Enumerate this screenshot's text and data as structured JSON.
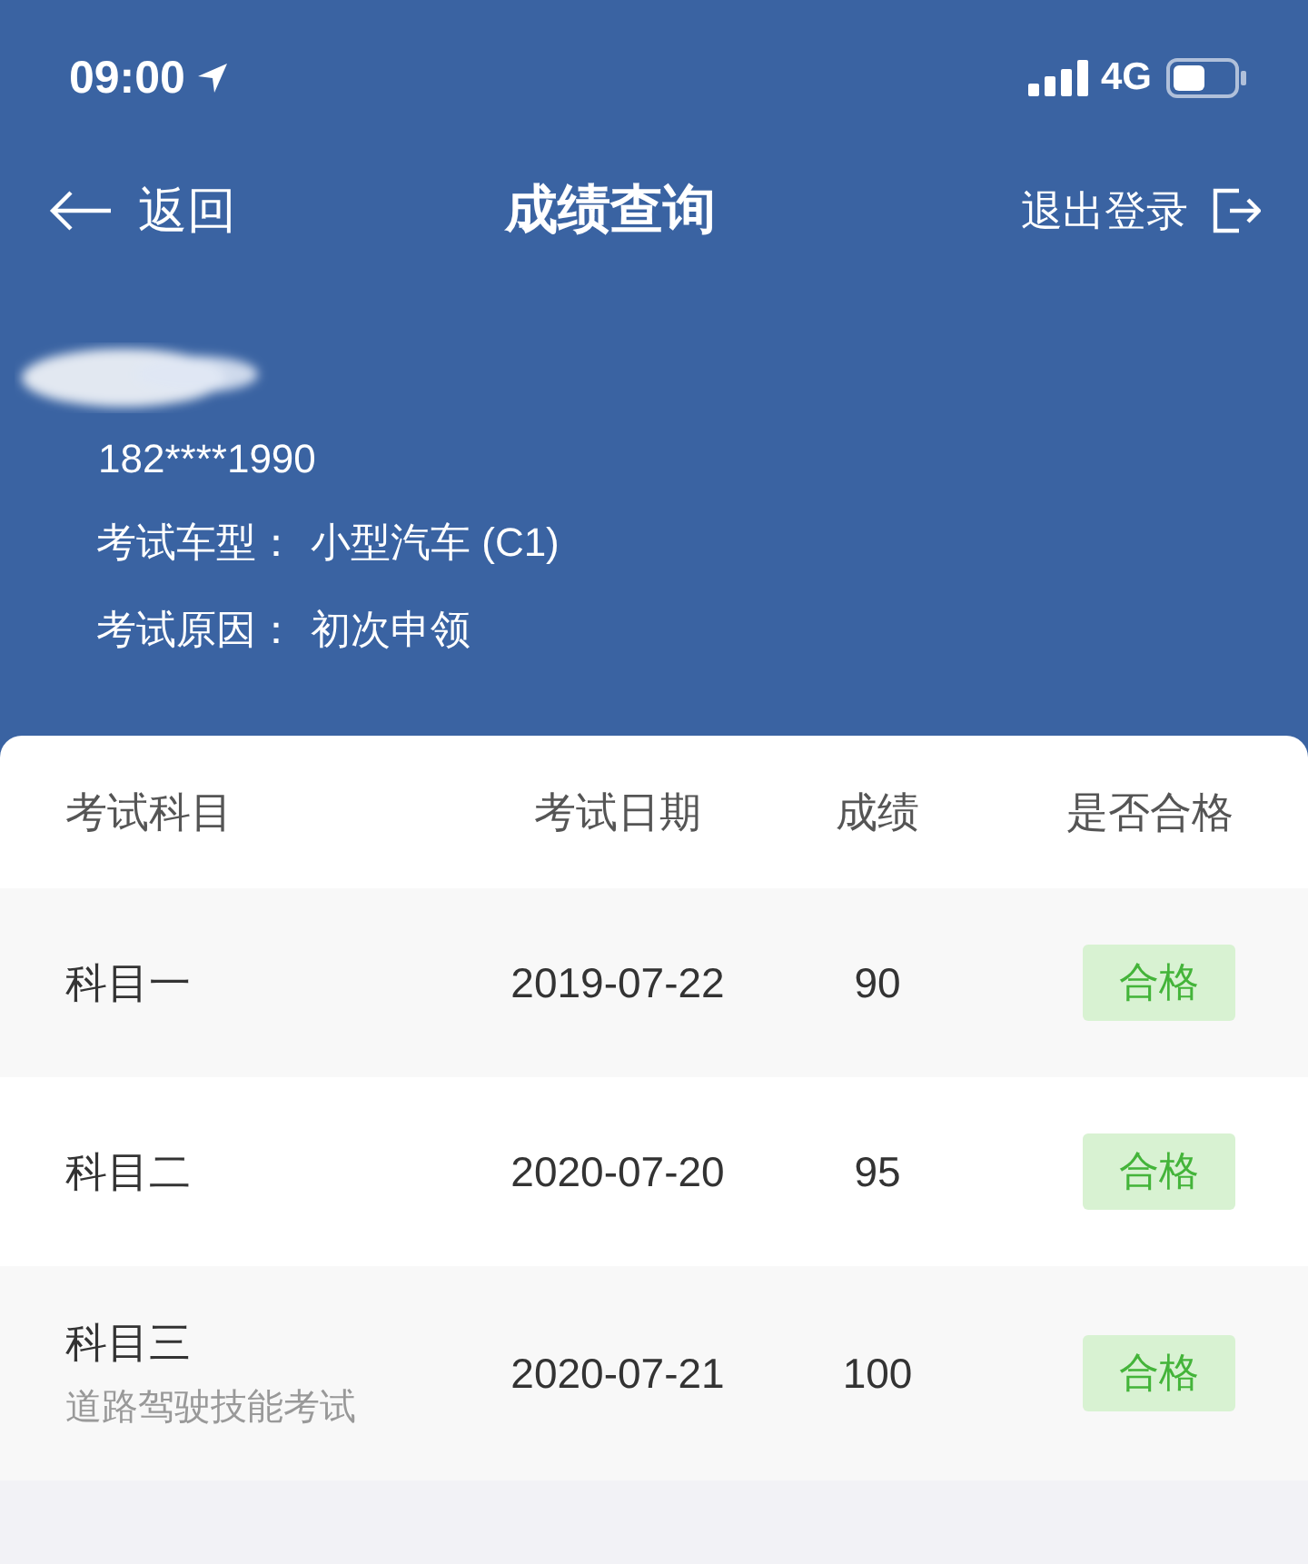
{
  "status_bar": {
    "time": "09:00",
    "network": "4G"
  },
  "nav": {
    "back": "返回",
    "title": "成绩查询",
    "logout": "退出登录"
  },
  "profile": {
    "phone": "182****1990",
    "lines": [
      {
        "label": "考试车型：",
        "value": "小型汽车 (C1)"
      },
      {
        "label": "考试原因：",
        "value": "初次申领"
      }
    ]
  },
  "table": {
    "columns": [
      "考试科目",
      "考试日期",
      "成绩",
      "是否合格"
    ],
    "rows": [
      {
        "subject": "科目一",
        "date": "2019-07-22",
        "score": "90",
        "result": "合格",
        "passed": true
      },
      {
        "subject": "科目二",
        "date": "2020-07-20",
        "score": "95",
        "result": "合格",
        "passed": true
      },
      {
        "subject": "科目三",
        "subtitle": "道路驾驶技能考试",
        "date": "2020-07-21",
        "score": "100",
        "result": "合格",
        "passed": true
      }
    ]
  }
}
